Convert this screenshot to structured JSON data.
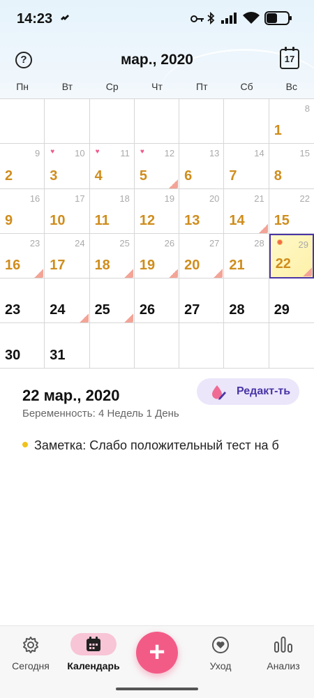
{
  "status_bar": {
    "time": "14:23"
  },
  "header": {
    "month": "мар., 2020",
    "today_day": "17"
  },
  "weekdays": [
    "Пн",
    "Вт",
    "Ср",
    "Чт",
    "Пт",
    "Сб",
    "Вс"
  ],
  "calendar": {
    "rows": [
      [
        {
          "small": "",
          "big": "",
          "style": "",
          "heart": false,
          "note": false
        },
        {
          "small": "",
          "big": "",
          "style": "",
          "heart": false,
          "note": false
        },
        {
          "small": "",
          "big": "",
          "style": "",
          "heart": false,
          "note": false
        },
        {
          "small": "",
          "big": "",
          "style": "",
          "heart": false,
          "note": false
        },
        {
          "small": "",
          "big": "",
          "style": "",
          "heart": false,
          "note": false
        },
        {
          "small": "",
          "big": "",
          "style": "",
          "heart": false,
          "note": false
        },
        {
          "small": "8",
          "big": "1",
          "style": "period",
          "heart": false,
          "note": false
        }
      ],
      [
        {
          "small": "9",
          "big": "2",
          "style": "period",
          "heart": false,
          "note": false
        },
        {
          "small": "10",
          "big": "3",
          "style": "period",
          "heart": true,
          "note": false
        },
        {
          "small": "11",
          "big": "4",
          "style": "period",
          "heart": true,
          "note": false
        },
        {
          "small": "12",
          "big": "5",
          "style": "period",
          "heart": true,
          "note": true
        },
        {
          "small": "13",
          "big": "6",
          "style": "period",
          "heart": false,
          "note": false
        },
        {
          "small": "14",
          "big": "7",
          "style": "period",
          "heart": false,
          "note": false
        },
        {
          "small": "15",
          "big": "8",
          "style": "period",
          "heart": false,
          "note": false
        }
      ],
      [
        {
          "small": "16",
          "big": "9",
          "style": "period",
          "heart": false,
          "note": false
        },
        {
          "small": "17",
          "big": "10",
          "style": "period",
          "heart": false,
          "note": false
        },
        {
          "small": "18",
          "big": "11",
          "style": "period",
          "heart": false,
          "note": false
        },
        {
          "small": "19",
          "big": "12",
          "style": "period",
          "heart": false,
          "note": false
        },
        {
          "small": "20",
          "big": "13",
          "style": "period",
          "heart": false,
          "note": false
        },
        {
          "small": "21",
          "big": "14",
          "style": "period",
          "heart": false,
          "note": true
        },
        {
          "small": "22",
          "big": "15",
          "style": "period",
          "heart": false,
          "note": false
        }
      ],
      [
        {
          "small": "23",
          "big": "16",
          "style": "period",
          "heart": false,
          "note": true
        },
        {
          "small": "24",
          "big": "17",
          "style": "period",
          "heart": false,
          "note": false
        },
        {
          "small": "25",
          "big": "18",
          "style": "period",
          "heart": false,
          "note": true
        },
        {
          "small": "26",
          "big": "19",
          "style": "period",
          "heart": false,
          "note": true
        },
        {
          "small": "27",
          "big": "20",
          "style": "period",
          "heart": false,
          "note": true
        },
        {
          "small": "28",
          "big": "21",
          "style": "period",
          "heart": false,
          "note": false
        },
        {
          "small": "29",
          "big": "22",
          "style": "period",
          "heart": false,
          "note": true,
          "selected": true
        }
      ],
      [
        {
          "small": "",
          "big": "23",
          "style": "future",
          "heart": false,
          "note": false
        },
        {
          "small": "",
          "big": "24",
          "style": "future",
          "heart": false,
          "note": true
        },
        {
          "small": "",
          "big": "25",
          "style": "future",
          "heart": false,
          "note": true
        },
        {
          "small": "",
          "big": "26",
          "style": "future",
          "heart": false,
          "note": false
        },
        {
          "small": "",
          "big": "27",
          "style": "future",
          "heart": false,
          "note": false
        },
        {
          "small": "",
          "big": "28",
          "style": "future",
          "heart": false,
          "note": false
        },
        {
          "small": "",
          "big": "29",
          "style": "future",
          "heart": false,
          "note": false
        }
      ],
      [
        {
          "small": "",
          "big": "30",
          "style": "future",
          "heart": false,
          "note": false
        },
        {
          "small": "",
          "big": "31",
          "style": "future",
          "heart": false,
          "note": false
        },
        {
          "small": "",
          "big": "",
          "style": "",
          "heart": false,
          "note": false
        },
        {
          "small": "",
          "big": "",
          "style": "",
          "heart": false,
          "note": false
        },
        {
          "small": "",
          "big": "",
          "style": "",
          "heart": false,
          "note": false
        },
        {
          "small": "",
          "big": "",
          "style": "",
          "heart": false,
          "note": false
        },
        {
          "small": "",
          "big": "",
          "style": "",
          "heart": false,
          "note": false
        }
      ]
    ]
  },
  "detail": {
    "date": "22 мар., 2020",
    "subtitle": "Беременность: 4 Недель 1 День",
    "edit_label": "Редакт-ть",
    "note": "Заметка: Слабо положительный тест на б"
  },
  "colors": {
    "period": "#cf8d1d",
    "accent_pink": "#f35b87",
    "accent_purple": "#4a35a6",
    "selected_bg": "#fdf0a8",
    "heart": "#ef5b8c",
    "note_fold": "#f3a497"
  },
  "nav": {
    "today": "Сегодня",
    "calendar": "Календарь",
    "add": "+",
    "care": "Уход",
    "analysis": "Анализ"
  },
  "icons": {
    "status": [
      "key-icon",
      "bluetooth-icon",
      "signal-icon",
      "wifi-icon",
      "battery-icon"
    ],
    "nav": [
      "gear-icon",
      "calendar-icon",
      "plus-icon",
      "heart-icon",
      "bar-chart-icon"
    ]
  }
}
